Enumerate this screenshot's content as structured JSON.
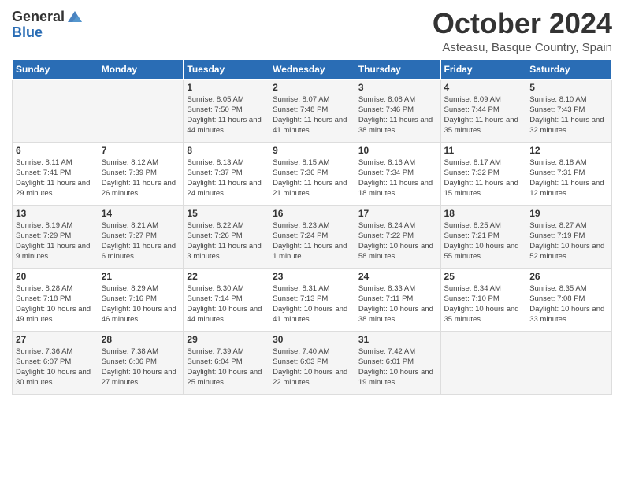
{
  "header": {
    "logo_general": "General",
    "logo_blue": "Blue",
    "month_title": "October 2024",
    "location": "Asteasu, Basque Country, Spain"
  },
  "days_of_week": [
    "Sunday",
    "Monday",
    "Tuesday",
    "Wednesday",
    "Thursday",
    "Friday",
    "Saturday"
  ],
  "weeks": [
    [
      {
        "day": "",
        "info": ""
      },
      {
        "day": "",
        "info": ""
      },
      {
        "day": "1",
        "info": "Sunrise: 8:05 AM\nSunset: 7:50 PM\nDaylight: 11 hours and 44 minutes."
      },
      {
        "day": "2",
        "info": "Sunrise: 8:07 AM\nSunset: 7:48 PM\nDaylight: 11 hours and 41 minutes."
      },
      {
        "day": "3",
        "info": "Sunrise: 8:08 AM\nSunset: 7:46 PM\nDaylight: 11 hours and 38 minutes."
      },
      {
        "day": "4",
        "info": "Sunrise: 8:09 AM\nSunset: 7:44 PM\nDaylight: 11 hours and 35 minutes."
      },
      {
        "day": "5",
        "info": "Sunrise: 8:10 AM\nSunset: 7:43 PM\nDaylight: 11 hours and 32 minutes."
      }
    ],
    [
      {
        "day": "6",
        "info": "Sunrise: 8:11 AM\nSunset: 7:41 PM\nDaylight: 11 hours and 29 minutes."
      },
      {
        "day": "7",
        "info": "Sunrise: 8:12 AM\nSunset: 7:39 PM\nDaylight: 11 hours and 26 minutes."
      },
      {
        "day": "8",
        "info": "Sunrise: 8:13 AM\nSunset: 7:37 PM\nDaylight: 11 hours and 24 minutes."
      },
      {
        "day": "9",
        "info": "Sunrise: 8:15 AM\nSunset: 7:36 PM\nDaylight: 11 hours and 21 minutes."
      },
      {
        "day": "10",
        "info": "Sunrise: 8:16 AM\nSunset: 7:34 PM\nDaylight: 11 hours and 18 minutes."
      },
      {
        "day": "11",
        "info": "Sunrise: 8:17 AM\nSunset: 7:32 PM\nDaylight: 11 hours and 15 minutes."
      },
      {
        "day": "12",
        "info": "Sunrise: 8:18 AM\nSunset: 7:31 PM\nDaylight: 11 hours and 12 minutes."
      }
    ],
    [
      {
        "day": "13",
        "info": "Sunrise: 8:19 AM\nSunset: 7:29 PM\nDaylight: 11 hours and 9 minutes."
      },
      {
        "day": "14",
        "info": "Sunrise: 8:21 AM\nSunset: 7:27 PM\nDaylight: 11 hours and 6 minutes."
      },
      {
        "day": "15",
        "info": "Sunrise: 8:22 AM\nSunset: 7:26 PM\nDaylight: 11 hours and 3 minutes."
      },
      {
        "day": "16",
        "info": "Sunrise: 8:23 AM\nSunset: 7:24 PM\nDaylight: 11 hours and 1 minute."
      },
      {
        "day": "17",
        "info": "Sunrise: 8:24 AM\nSunset: 7:22 PM\nDaylight: 10 hours and 58 minutes."
      },
      {
        "day": "18",
        "info": "Sunrise: 8:25 AM\nSunset: 7:21 PM\nDaylight: 10 hours and 55 minutes."
      },
      {
        "day": "19",
        "info": "Sunrise: 8:27 AM\nSunset: 7:19 PM\nDaylight: 10 hours and 52 minutes."
      }
    ],
    [
      {
        "day": "20",
        "info": "Sunrise: 8:28 AM\nSunset: 7:18 PM\nDaylight: 10 hours and 49 minutes."
      },
      {
        "day": "21",
        "info": "Sunrise: 8:29 AM\nSunset: 7:16 PM\nDaylight: 10 hours and 46 minutes."
      },
      {
        "day": "22",
        "info": "Sunrise: 8:30 AM\nSunset: 7:14 PM\nDaylight: 10 hours and 44 minutes."
      },
      {
        "day": "23",
        "info": "Sunrise: 8:31 AM\nSunset: 7:13 PM\nDaylight: 10 hours and 41 minutes."
      },
      {
        "day": "24",
        "info": "Sunrise: 8:33 AM\nSunset: 7:11 PM\nDaylight: 10 hours and 38 minutes."
      },
      {
        "day": "25",
        "info": "Sunrise: 8:34 AM\nSunset: 7:10 PM\nDaylight: 10 hours and 35 minutes."
      },
      {
        "day": "26",
        "info": "Sunrise: 8:35 AM\nSunset: 7:08 PM\nDaylight: 10 hours and 33 minutes."
      }
    ],
    [
      {
        "day": "27",
        "info": "Sunrise: 7:36 AM\nSunset: 6:07 PM\nDaylight: 10 hours and 30 minutes."
      },
      {
        "day": "28",
        "info": "Sunrise: 7:38 AM\nSunset: 6:06 PM\nDaylight: 10 hours and 27 minutes."
      },
      {
        "day": "29",
        "info": "Sunrise: 7:39 AM\nSunset: 6:04 PM\nDaylight: 10 hours and 25 minutes."
      },
      {
        "day": "30",
        "info": "Sunrise: 7:40 AM\nSunset: 6:03 PM\nDaylight: 10 hours and 22 minutes."
      },
      {
        "day": "31",
        "info": "Sunrise: 7:42 AM\nSunset: 6:01 PM\nDaylight: 10 hours and 19 minutes."
      },
      {
        "day": "",
        "info": ""
      },
      {
        "day": "",
        "info": ""
      }
    ]
  ]
}
